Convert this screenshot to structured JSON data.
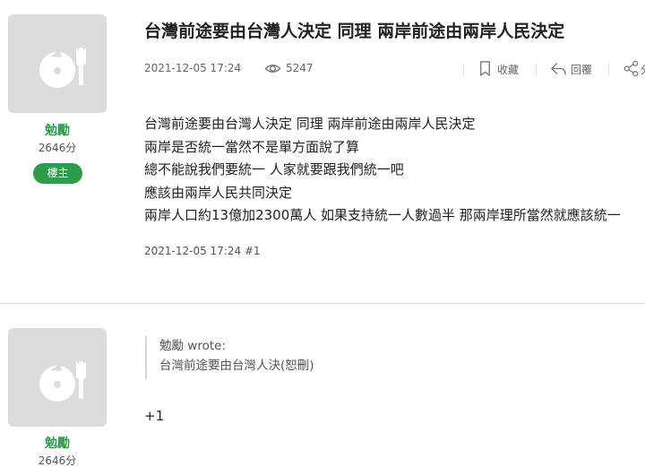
{
  "thread": {
    "title": "台灣前途要由台灣人決定 同理 兩岸前途由兩岸人民決定"
  },
  "posts": [
    {
      "author": {
        "name": "勉勵",
        "score": "2646分",
        "badge": "樓主",
        "avatar_icon": "default-avatar-icon"
      },
      "date": "2021-12-05 17:24",
      "views": "5247",
      "actions": {
        "favorite": "收藏",
        "reply": "回覆",
        "share": "分享"
      },
      "lines": [
        "台灣前途要由台灣人決定 同理 兩岸前途由兩岸人民決定",
        "兩岸是否統一當然不是單方面說了算",
        "總不能說我們要統一 人家就要跟我們統一吧",
        "應該由兩岸人民共同決定",
        "兩岸人口約13億加2300萬人 如果支持統一人數過半 那兩岸理所當然就應該統一"
      ],
      "footer": "2021-12-05 17:24 #1"
    },
    {
      "author": {
        "name": "勉勵",
        "score": "2646分",
        "avatar_icon": "default-avatar-icon"
      },
      "quote": {
        "author": "勉勵 wrote:",
        "text": "台灣前途要由台灣人決(恕刪)"
      },
      "body": "+1"
    }
  ],
  "colors": {
    "accent_green": "#2e9b4a",
    "avatar_bg": "#dcdcdc",
    "muted_text": "#666666"
  }
}
